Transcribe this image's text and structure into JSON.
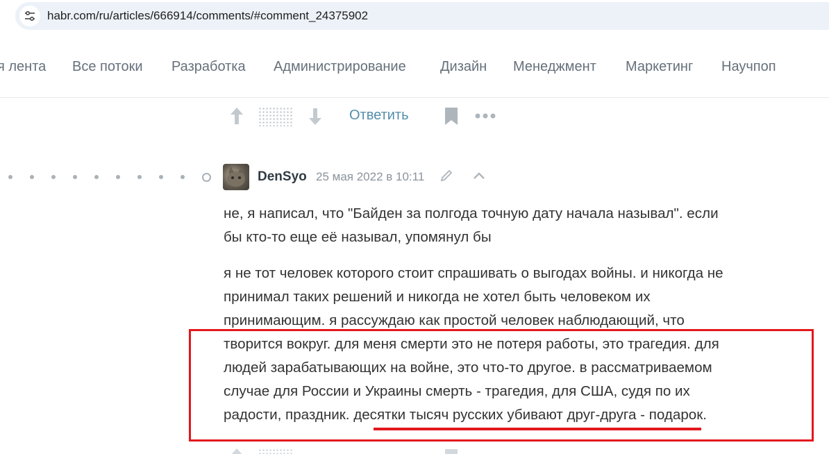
{
  "browser": {
    "url": "habr.com/ru/articles/666914/comments/#comment_24375902"
  },
  "nav": {
    "items": [
      {
        "label": "я лента",
        "x": 0
      },
      {
        "label": "Все потоки"
      },
      {
        "label": "Разработка"
      },
      {
        "label": "Администрирование"
      },
      {
        "label": "Дизайн"
      },
      {
        "label": "Менеджмент"
      },
      {
        "label": "Маркетинг"
      },
      {
        "label": "Научпоп"
      }
    ]
  },
  "actions": {
    "reply_label": "Ответить",
    "icons": [
      "arrow-up-icon",
      "arrow-down-icon",
      "bookmark-icon",
      "more-icon"
    ]
  },
  "comment": {
    "author": "DenSyo",
    "date": "25 мая 2022 в 10:11",
    "paragraph1": [
      "не, я написал, что \"Байден за полгода точную дату начала называл\". если",
      "бы кто-то еще её называл, упомянул бы"
    ],
    "paragraph2": [
      "я не тот человек которого стоит спрашивать о выгодах войны. и никогда не",
      "принимал таких решений и никогда не хотел быть человеком их",
      "принимающим. я рассуждаю как простой человек наблюдающий, что",
      "творится вокруг. для меня смерти это не потеря работы, это трагедия. для",
      "людей зарабатывающих на войне, это что-то другое. в рассматриваемом",
      "случае для России и Украины смерть - трагедия, для США, судя по их",
      "радости, праздник. десятки тысяч русских убивают друг-друга - подарок."
    ]
  },
  "colors": {
    "accent": "#548eaa",
    "annotation": "#e4171d",
    "nav_text": "#65707b"
  }
}
